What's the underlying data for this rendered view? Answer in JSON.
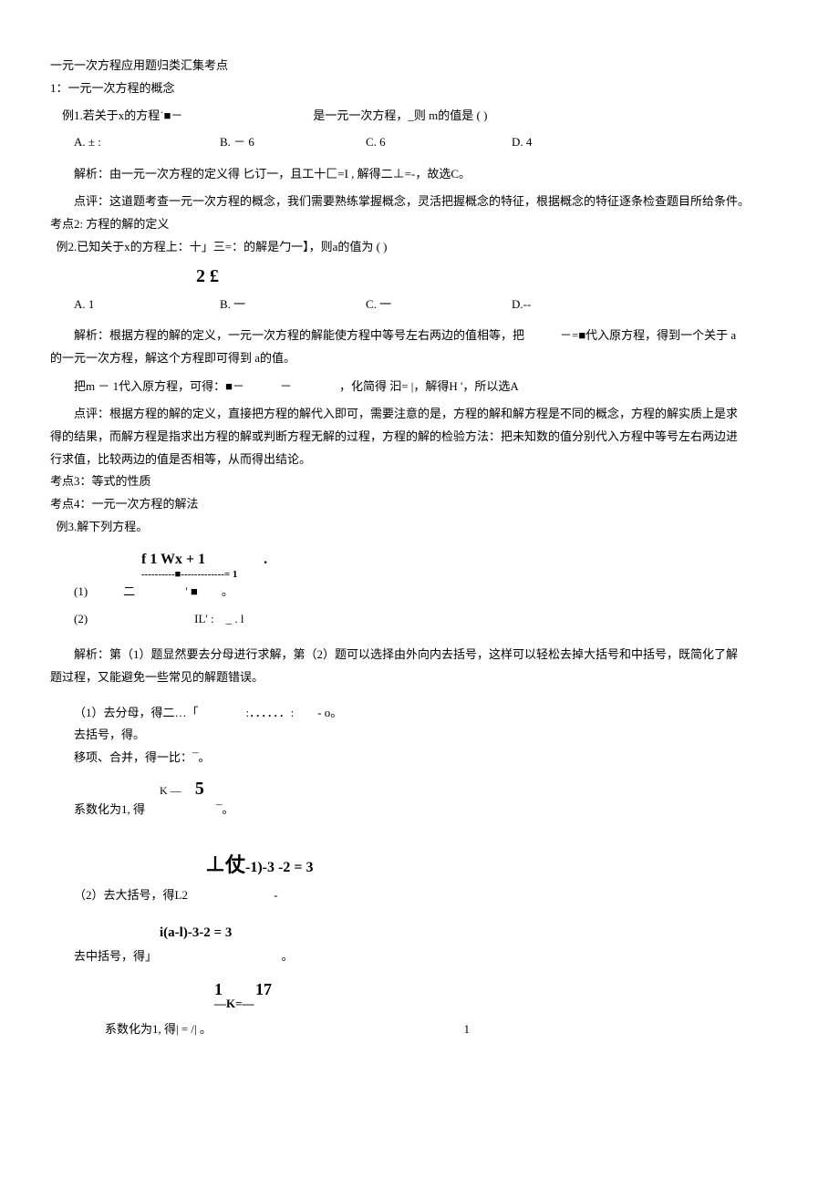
{
  "title": "一元一次方程应用题归类汇集考点",
  "kp1_title": "1：一元一次方程的概念",
  "ex1_stem": "例1.若关于x的方程˙■－　　　　　　　　　　　是一元一次方程，_则 m的值是 ( )",
  "ex1_opts": {
    "a": "A. ± :",
    "b": "B. －  6",
    "c": "C. 6",
    "d": "D. 4"
  },
  "ex1_analysis": "解析：由一元一次方程的定义得  匕订一，且工十匚=I , 解得二⊥=-，故选C。",
  "ex1_comment": "点评：这道题考查一元一次方程的概念，我们需要熟练掌握概念，灵活把握概念的特征，根据概念的特征逐条检查题目所给条件。",
  "kp2_title": "考点2: 方程的解的定义",
  "ex2_stem": "例2.已知关于x的方程上：十」三=：的解是勹一】，则a的值为 ( )",
  "ex2_eq": "2 £",
  "ex2_opts": {
    "a": "A. 1",
    "b": "B. 一",
    "c": "C. 一",
    "d": "D.--"
  },
  "ex2_analysis1": "解析：根据方程的解的定义，一元一次方程的解能使方程中等号左右两边的值相等，把　　　－=■代入原方程，得到一个关于 a",
  "ex2_analysis2": "的一元一次方程，解这个方程即可得到 a的值。",
  "ex2_sub": "把m －  1代入原方程，可得：■－　　　－　　　　，化简得 汩= |，解得H '，所以选A",
  "ex2_comment1": "点评：根据方程的解的定义，直接把方程的解代入即可，需要注意的是，方程的解和解方程是不同的概念，方程的解实质上是求",
  "ex2_comment2": "得的结果，而解方程是指求出方程的解或判断方程无解的过程，方程的解的检验方法：把未知数的值分别代入方程中等号左右两边进",
  "ex2_comment3": "行求值，比较两边的值是否相等，从而得出结论。",
  "kp3": "考点3：等式的性质",
  "kp4": "考点4：一元一次方程的解法",
  "ex3_stem": "例3.解下列方程。",
  "ex3_frac_top": "f 1  Wx + 1　　　　.",
  "ex3_frac_line": "----------■-------------= 1",
  "ex3_eq1": "(1)　　　二　　　　 ' ■　　。",
  "ex3_eq2": "(2)　　　　　　　　　IL'  :　_ . l",
  "ex3_analysis1": "解析：第（1）题显然要去分母进行求解，第（2）题可以选择由外向内去括号，这样可以轻松去掉大括号和中括号，既简化了解",
  "ex3_analysis2": "题过程，又能避免一些常见的解题错误。",
  "ex3_s1": "（1）去分母，得二…「　　　　:．．．．．．:　　- o。",
  "ex3_s2": "去括号，得。",
  "ex3_s3": "移项、合并，得一比：¯。",
  "ex3_s4a": "K ―　",
  "ex3_s4b": "5",
  "ex3_s4": "系数化为1, 得　　　　　　¯。",
  "ex3_p2_eq": "⊥仗",
  "ex3_p2_tail": "-1)-3 -2 = 3",
  "ex3_p2": "（2）去大括号，得L2　　　　　　　 -",
  "ex3_mid_eq": "i(a-l)-3-2 = 3",
  "ex3_mid": "去中括号，得」　　　　　　　　　　　。",
  "ex3_last_eq": "1　　17",
  "ex3_last_eq2": "—K=—",
  "ex3_last": "系数化为1, 得|  = /|  。",
  "page": "1"
}
